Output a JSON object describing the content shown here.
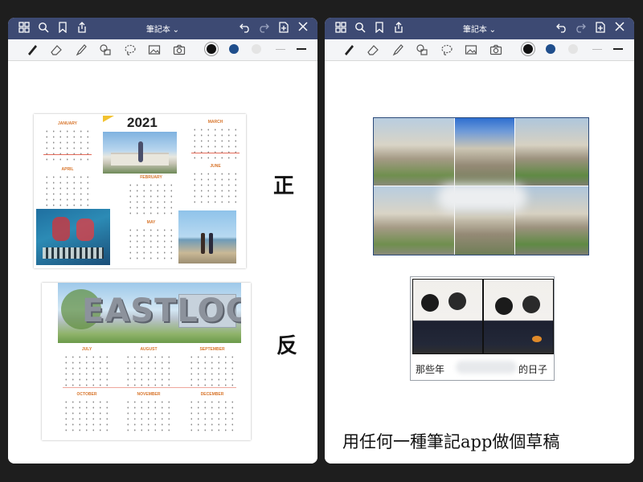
{
  "left_pane": {
    "title": "筆記本 ⌄",
    "page": {
      "calendar_year": "2021",
      "front_label": "正",
      "back_label": "反",
      "front_months": [
        "JANUARY",
        "MARCH",
        "APRIL",
        "FEBRUARY",
        "JUNE",
        "MAY"
      ],
      "back_months": [
        "JULY",
        "AUGUST",
        "SEPTEMBER",
        "OCTOBER",
        "NOVEMBER",
        "DECEMBER"
      ],
      "back_banner_text": "EASTLOOP"
    }
  },
  "right_pane": {
    "title": "筆記本 ⌄",
    "page": {
      "caption_left": "那些年",
      "caption_right": "的日子",
      "bottom_text": "用任何一種筆記app做個草稿"
    }
  },
  "colors": {
    "titlebar": "#3d4a73",
    "toolbar": "#f4f5f7",
    "month_accent": "#d8762d",
    "ink_black": "#111111",
    "ink_blue": "#1f4e8c"
  },
  "icons": [
    "grid-icon",
    "search-icon",
    "bookmark-icon",
    "share-icon",
    "undo-icon",
    "redo-icon",
    "add-page-icon",
    "close-icon",
    "pen-icon",
    "eraser-icon",
    "highlighter-icon",
    "shapes-icon",
    "lasso-icon",
    "image-icon",
    "camera-icon"
  ]
}
